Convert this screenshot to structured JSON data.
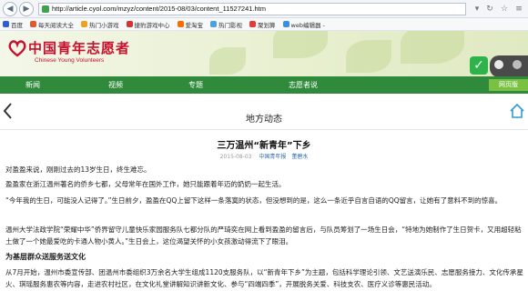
{
  "browser": {
    "url": "http://article.cyol.com/mzyz/content/2015-08/03/content_11527241.htm",
    "bookmarks": [
      "百度",
      "每天阅读大全",
      "热门小游戏",
      "捷豹游戏中心",
      "爱淘宝",
      "热门影视",
      "聚划算",
      "web编辑器 -"
    ]
  },
  "header": {
    "logo_cn": "中国青年志愿者",
    "logo_en": "Chinese Young Volunteers"
  },
  "nav": {
    "items": [
      "新闻",
      "视频",
      "专题",
      "志愿者说"
    ],
    "right_button": "网页版"
  },
  "section": {
    "title": "地方动态"
  },
  "article": {
    "title": "三万温州“新青年”下乡",
    "date": "2015-08-03",
    "source": "中国青年报",
    "author": "董碧水",
    "paragraphs": [
      "对盈盈来说，刚刚过去的13岁生日，终生难忘。",
      "盈盈家在浙江温州著名的侨乡七都，父母常年在国外工作，她只能跟着年迈的奶奶一起生活。",
      "“今年我的生日，可能没人记得了。”生日前夕，盈盈在QQ上留下这样一条落寞的状态，但没想到的是，这么一条近乎自言自语的QQ留言，让她有了意料不到的惊喜。",
      "温州大学法政学院“荣耀中华”侨界留守儿童快乐家园服务队七都分队的严琦奕在网上看到盈盈的留言后，与队员筹划了一场生日会，“特地为她制作了生日贺卡，又用超轻粘土做了一个她最爱吃的卡通人物小黄人。”生日会上，这位渴望关怀的小女孩激动得流下了眼泪。",
      "为基层群众送服务送文化",
      "从7月开始，温州市委宣传部、团温州市委组织3万余名大学生组成1120支服务队，以“新青年下乡”为主题，包括科学理论引领、文艺送演乐民、志愿服务接力、文化传承星火、琪瑶服务惠农等内容，走进农村社区，在文化礼堂讲解知识讲新文化、参与“四端四季”，开展脱务关爱、科技支农、医疗义诊等惠民活动。"
    ]
  },
  "colors": {
    "nav_green": "#2f8a3b",
    "logo_red": "#c8102e",
    "badge_green": "#2eb34a"
  }
}
